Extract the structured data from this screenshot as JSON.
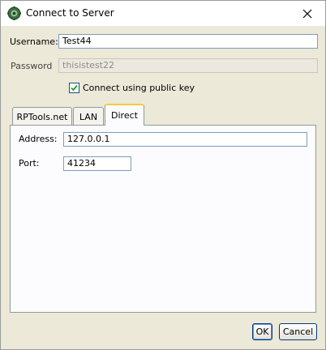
{
  "window": {
    "title": "Connect to Server"
  },
  "form": {
    "username_label": "Username:",
    "username_value": "Test44",
    "password_label": "Password",
    "password_value": "thisistest22",
    "public_key_label": "Connect using public key",
    "public_key_checked": true
  },
  "tabs": [
    {
      "label": "RPTools.net",
      "active": false
    },
    {
      "label": "LAN",
      "active": false
    },
    {
      "label": "Direct",
      "active": true
    }
  ],
  "direct": {
    "address_label": "Address:",
    "address_value": "127.0.0.1",
    "port_label": "Port:",
    "port_value": "41234"
  },
  "buttons": {
    "ok": "OK",
    "cancel": "Cancel"
  },
  "icons": {
    "app": "gear-app-icon",
    "close": "close-icon",
    "check": "check-icon"
  },
  "colors": {
    "accent_tab": "#ffc83c",
    "dialog_bg": "#ece9d8",
    "field_border": "#7f9db9"
  }
}
